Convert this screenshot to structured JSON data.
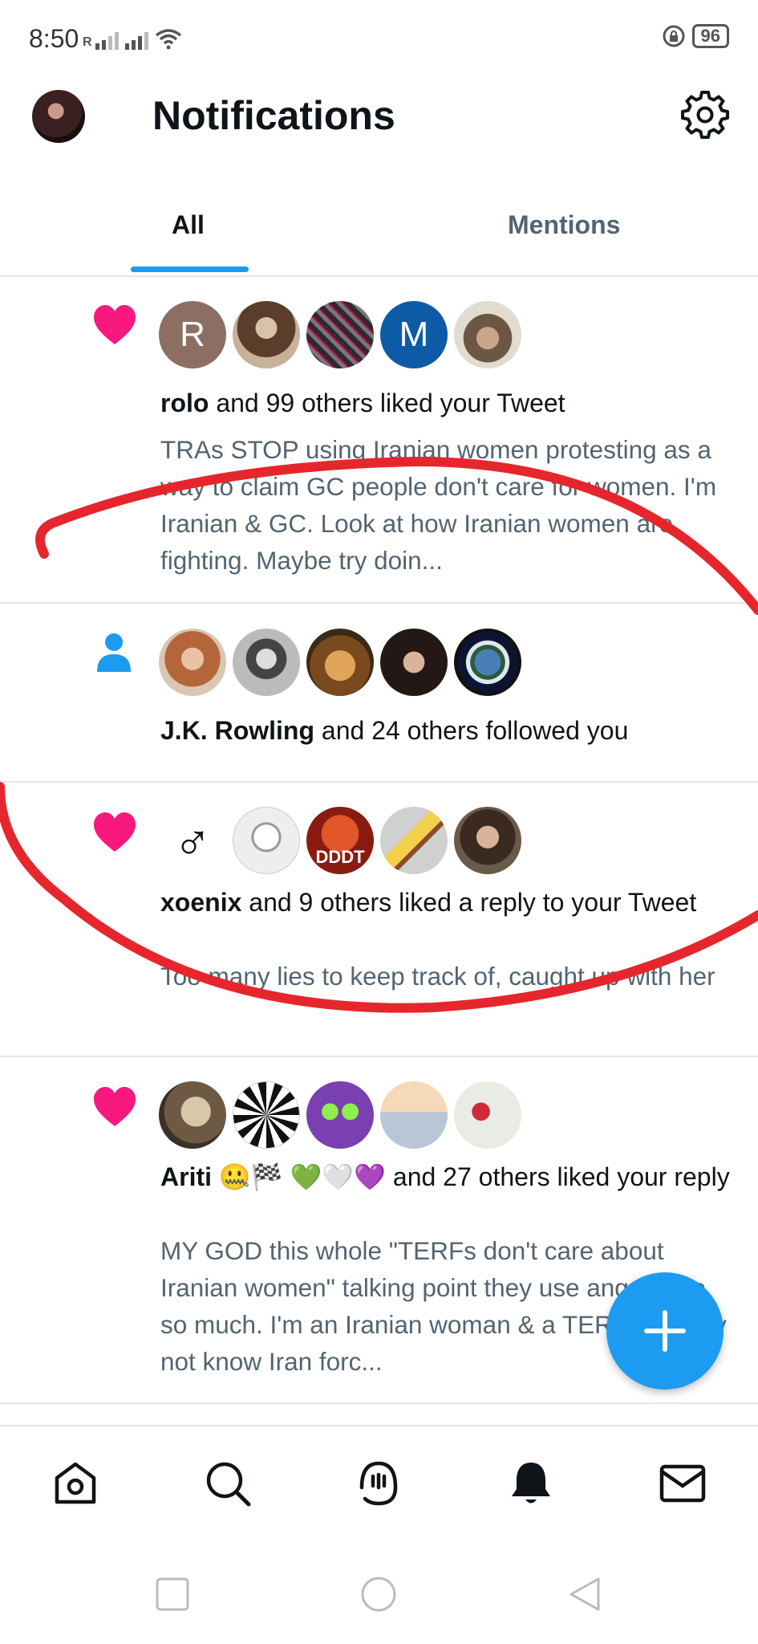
{
  "status_bar": {
    "time": "8:50",
    "signal_label": "R",
    "battery": "96"
  },
  "header": {
    "title": "Notifications"
  },
  "tabs": [
    {
      "label": "All"
    },
    {
      "label": "Mentions"
    }
  ],
  "notifications": [
    {
      "icon": "heart-icon",
      "avatars": [
        "R",
        "",
        "",
        "M",
        ""
      ],
      "actor": "rolo",
      "rest": " and 99 others liked your Tweet",
      "snippet": "TRAs STOP using Iranian women protesting as a way to claim GC people don't care for women. I'm Iranian & GC. Look at how Iranian women are fighting. Maybe try doin..."
    },
    {
      "icon": "person-icon",
      "actor": "J.K. Rowling",
      "rest": " and 24 others followed you"
    },
    {
      "icon": "heart-icon",
      "avatar_glyph": "♂",
      "actor": "xoenix",
      "rest": " and 9 others liked a reply to your Tweet",
      "snippet": "Too many lies to keep track of, caught up with her",
      "avatar3_text": "DDDT"
    },
    {
      "icon": "heart-icon",
      "actor": "Ariti 🤐🏁 💚🤍💜",
      "rest": " and 27 others liked your reply",
      "snippet": "MY GOD this whole \"TERFs don't care about Iranian women\" talking point they use angers me so much. I'm an Iranian woman & a TERF. Do they not know Iran forc..."
    }
  ],
  "colors": {
    "accent": "#1d9bf0",
    "heart": "#f91880",
    "scribble": "#e6262d"
  },
  "bottom_nav": [
    "home-icon",
    "search-icon",
    "spaces-icon",
    "notifications-bell-icon",
    "messages-icon"
  ]
}
